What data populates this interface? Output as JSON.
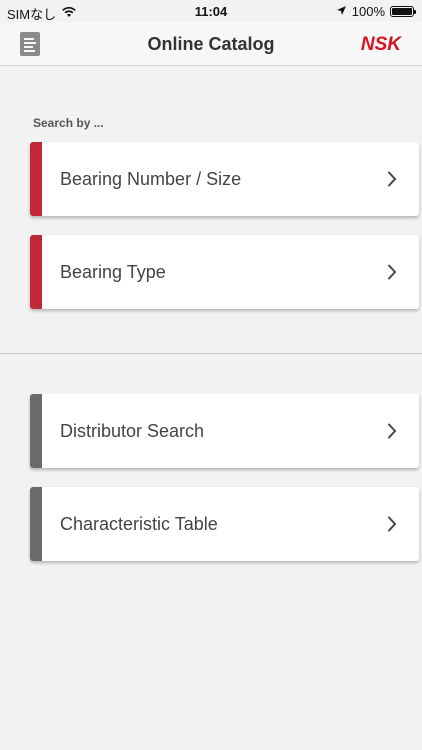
{
  "status_bar": {
    "carrier": "SIMなし",
    "time": "11:04",
    "battery": "100%",
    "battery_level": 1.0
  },
  "nav": {
    "title": "Online Catalog",
    "brand": "NSK",
    "left_icon": "document-icon"
  },
  "search_label": "Search by ...",
  "primary_items": [
    {
      "label": "Bearing Number / Size",
      "icon": "chevron-right-icon"
    },
    {
      "label": "Bearing Type",
      "icon": "chevron-right-icon"
    }
  ],
  "secondary_items": [
    {
      "label": "Distributor Search",
      "icon": "chevron-right-icon"
    },
    {
      "label": "Characteristic Table",
      "icon": "chevron-right-icon"
    }
  ],
  "colors": {
    "accent_primary": "#c0283a",
    "accent_secondary": "#6a6a6a",
    "brand": "#d7141f"
  }
}
